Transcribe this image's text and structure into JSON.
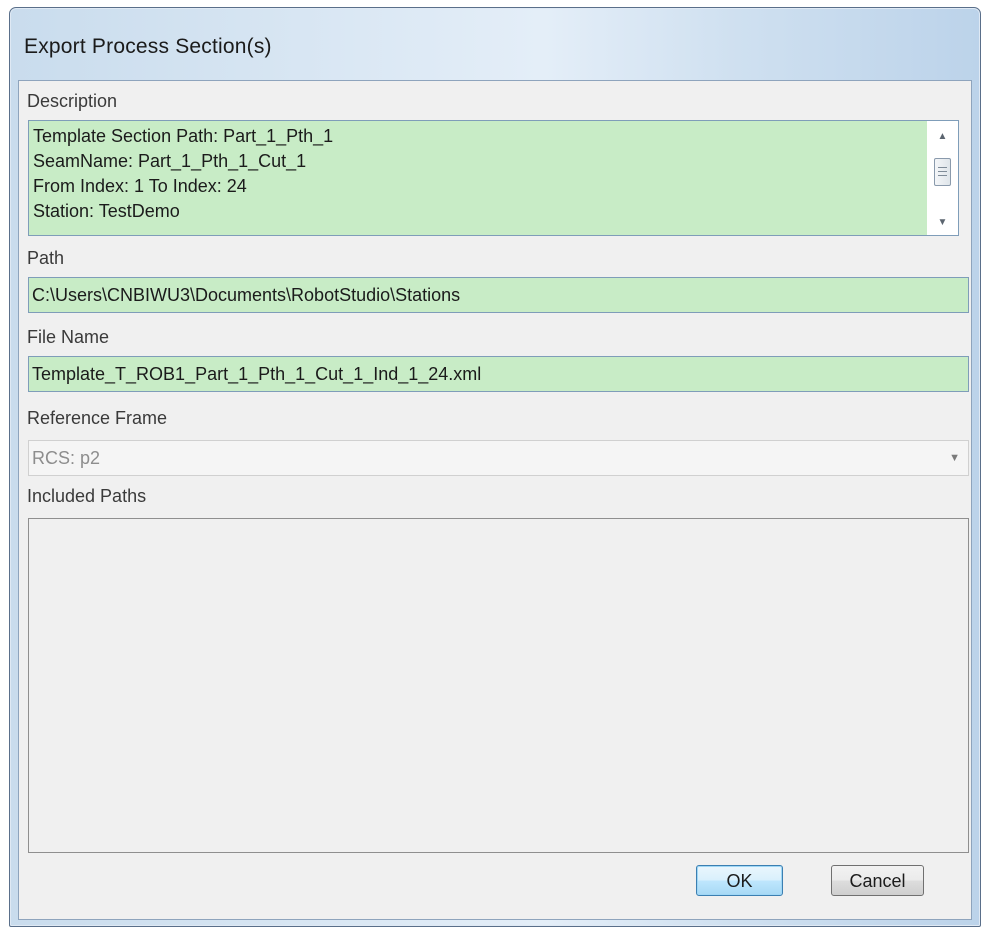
{
  "dialog": {
    "title": "Export Process Section(s)"
  },
  "description": {
    "label": "Description",
    "lines": [
      "Template Section Path: Part_1_Pth_1",
      "SeamName: Part_1_Pth_1_Cut_1",
      "From Index: 1 To Index: 24",
      "Station: TestDemo"
    ]
  },
  "path": {
    "label": "Path",
    "value": "C:\\Users\\CNBIWU3\\Documents\\RobotStudio\\Stations"
  },
  "file_name": {
    "label": "File Name",
    "value": "Template_T_ROB1_Part_1_Pth_1_Cut_1_Ind_1_24.xml"
  },
  "reference_frame": {
    "label": "Reference Frame",
    "selected": "RCS: p2"
  },
  "included_paths": {
    "label": "Included Paths",
    "items": []
  },
  "buttons": {
    "ok": "OK",
    "cancel": "Cancel"
  },
  "icons": {
    "scroll_up": "scroll-up-arrow-icon",
    "scroll_down": "scroll-down-arrow-icon",
    "dropdown": "chevron-down-icon"
  },
  "colors": {
    "field_background": "#c8ecc6",
    "dialog_background": "#f0f0f0",
    "default_button_border": "#3c7fb1"
  }
}
